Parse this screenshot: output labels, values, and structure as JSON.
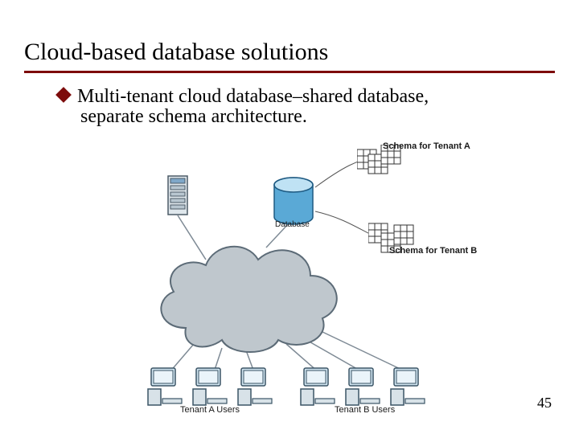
{
  "title": "Cloud-based database solutions",
  "bullet": {
    "line1": "Multi-tenant cloud database–shared database,",
    "line2": "separate schema architecture."
  },
  "figure": {
    "database_label": "Database",
    "schema_a": "Schema for Tenant A",
    "schema_b": "Schema for Tenant B",
    "tenant_a_users": "Tenant A Users",
    "tenant_b_users": "Tenant B Users"
  },
  "page_number": "45"
}
